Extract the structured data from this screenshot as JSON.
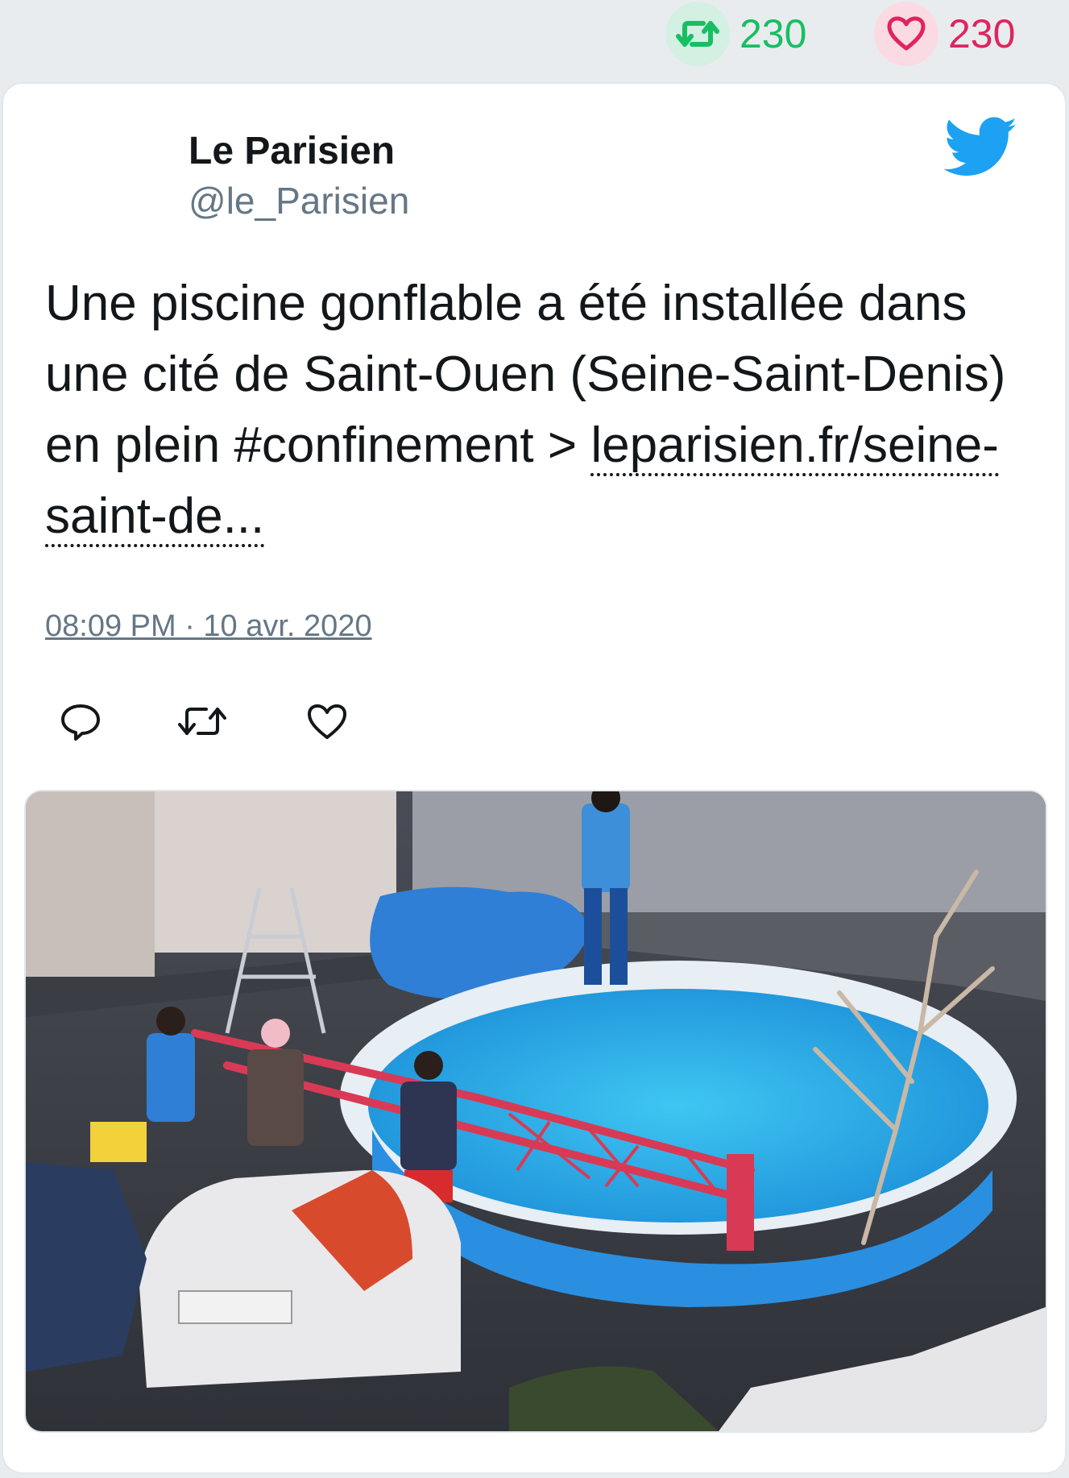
{
  "header": {
    "retweet_count": "230",
    "like_count": "230"
  },
  "tweet": {
    "author_name": "Le Parisien",
    "author_handle": "@le_Parisien",
    "text": "Une piscine gonflable a été installée dans une cité de Saint-Ouen (Seine-Saint-Denis) en plein #confinement > ",
    "link_text": "leparisien.fr/seine-saint-de...",
    "timestamp": "08:09 PM · 10 avr. 2020"
  },
  "icons": {
    "header_retweet": "retweet-icon",
    "header_like": "heart-icon",
    "brand": "twitter-bird-icon",
    "reply": "reply-icon",
    "retweet": "retweet-icon",
    "like": "heart-icon"
  },
  "colors": {
    "retweet_green": "#17bf63",
    "like_red": "#e0245e",
    "twitter_blue": "#1da1f2",
    "handle_gray": "#657786"
  }
}
